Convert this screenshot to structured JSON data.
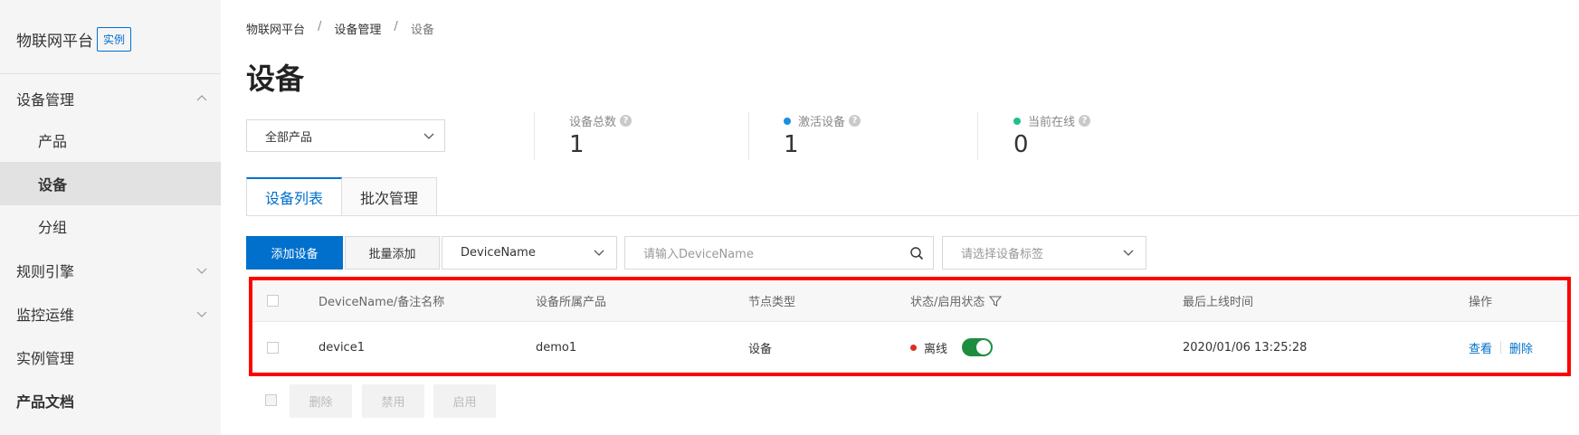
{
  "sidebar": {
    "brand": "物联网平台",
    "brand_tag": "实例",
    "items": [
      {
        "label": "设备管理"
      },
      {
        "label": "产品"
      },
      {
        "label": "设备"
      },
      {
        "label": "分组"
      },
      {
        "label": "规则引擎"
      },
      {
        "label": "监控运维"
      },
      {
        "label": "实例管理"
      },
      {
        "label": "产品文档"
      }
    ]
  },
  "breadcrumb": [
    "物联网平台",
    "设备管理",
    "设备"
  ],
  "breadcrumb_sep": "/",
  "page_title": "设备",
  "product_select": "全部产品",
  "stats": [
    {
      "label": "设备总数",
      "value": "1"
    },
    {
      "label": "激活设备",
      "value": "1",
      "dot_color": "#1a8fe3"
    },
    {
      "label": "当前在线",
      "value": "0",
      "dot_color": "#1fbf8f"
    }
  ],
  "help_mark": "?",
  "tabs": [
    "设备列表",
    "批次管理"
  ],
  "toolbar": {
    "add_device": "添加设备",
    "batch_add": "批量添加",
    "field_select": "DeviceName",
    "search_placeholder": "请输入DeviceName",
    "tag_select_placeholder": "请选择设备标签"
  },
  "table": {
    "headers": [
      "DeviceName/备注名称",
      "设备所属产品",
      "节点类型",
      "状态/启用状态",
      "最后上线时间",
      "操作"
    ],
    "rows": [
      {
        "name": "device1",
        "product": "demo1",
        "node_type": "设备",
        "status": "离线",
        "enabled": true,
        "last_online": "2020/01/06 13:25:28",
        "actions": [
          "查看",
          "删除"
        ]
      }
    ]
  },
  "bulk_actions": [
    "删除",
    "禁用",
    "启用"
  ],
  "colors": {
    "primary": "#0070cc",
    "highlight_border": "#ff0000",
    "offline": "#d93026",
    "toggle_on": "#1e8e3e"
  }
}
